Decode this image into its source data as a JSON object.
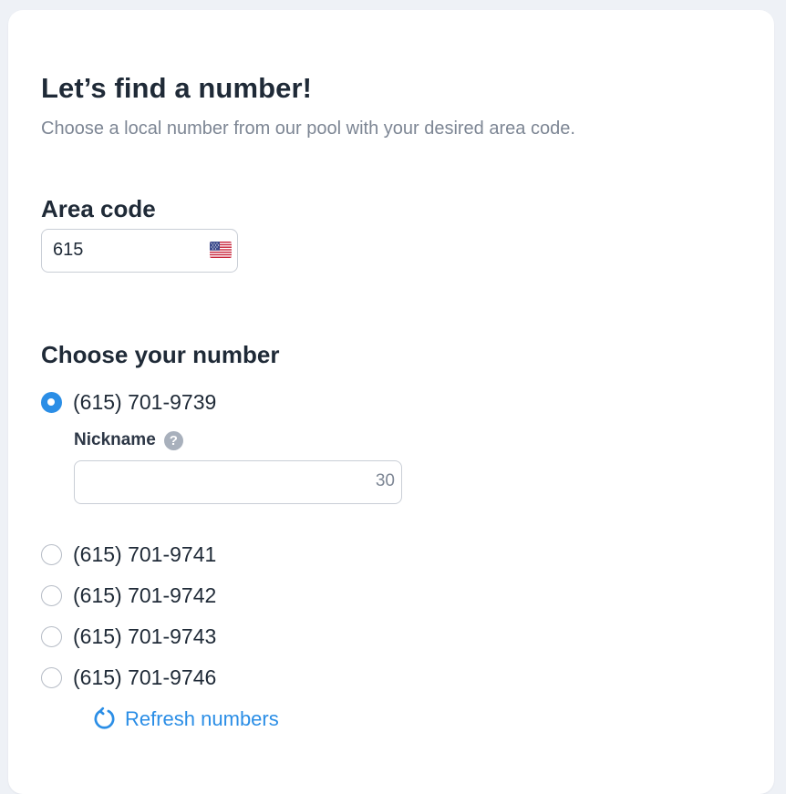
{
  "header": {
    "title": "Let’s find a number!",
    "subtitle": "Choose a local number from our pool with your desired area code."
  },
  "area_code": {
    "label": "Area code",
    "value": "615",
    "flag_icon": "us-flag-icon"
  },
  "numbers": {
    "label": "Choose your number",
    "selected_index": 0,
    "options": [
      {
        "label": "(615) 701-9739",
        "checked": true
      },
      {
        "label": "(615) 701-9741",
        "checked": false
      },
      {
        "label": "(615) 701-9742",
        "checked": false
      },
      {
        "label": "(615) 701-9743",
        "checked": false
      },
      {
        "label": "(615) 701-9746",
        "checked": false
      }
    ]
  },
  "nickname": {
    "label": "Nickname",
    "help_icon": "question-mark-icon",
    "help_glyph": "?",
    "value": "",
    "remaining": "30"
  },
  "refresh": {
    "label": "Refresh numbers",
    "icon": "refresh-icon"
  },
  "colors": {
    "accent": "#2b8ee6",
    "text": "#1f2a37",
    "muted": "#7d8694",
    "background": "#eef1f6"
  }
}
